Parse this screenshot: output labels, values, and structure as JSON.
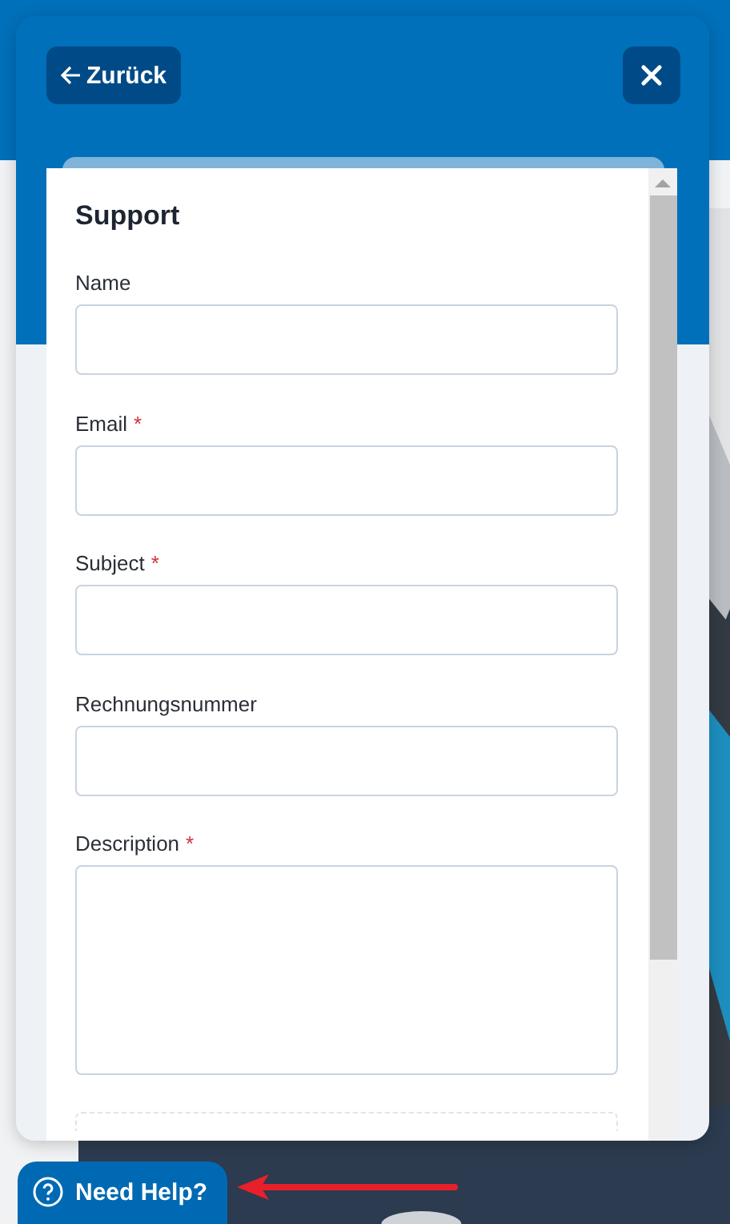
{
  "support_widget": {
    "back_button": {
      "label": "Zurück"
    },
    "form": {
      "title": "Support",
      "fields": [
        {
          "kind": "input",
          "label": "Name"
        },
        {
          "kind": "input",
          "label": "Email",
          "required_mark": "*"
        },
        {
          "kind": "input",
          "label": "Subject",
          "required_mark": "*"
        },
        {
          "kind": "input",
          "label": "Rechnungsnummer"
        },
        {
          "kind": "textarea",
          "label": "Description",
          "required_mark": "*"
        },
        {
          "kind": "dropzone"
        }
      ]
    }
  },
  "help_button": {
    "label": "Need Help?"
  }
}
